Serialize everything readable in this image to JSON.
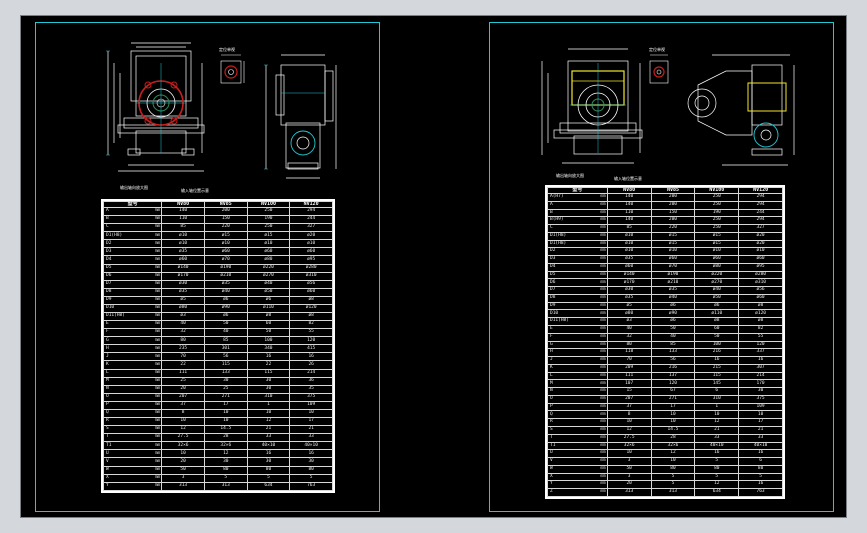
{
  "sheets": [
    {
      "captions": [
        "输出轴向放大图",
        "输入轴位置示意"
      ],
      "detail_label": "定位单视",
      "table": {
        "header": [
          "型号",
          "NV80",
          "NV85",
          "NV100",
          "NV120"
        ],
        "rows": [
          [
            "A",
            "mm",
            "140",
            "200",
            "250",
            "294"
          ],
          [
            "B",
            "mm",
            "110",
            "150",
            "190",
            "244"
          ],
          [
            "C",
            "mm",
            "85",
            "220",
            "250",
            "327"
          ],
          [
            "D1(H8)",
            "mm",
            "ø10",
            "ø15",
            "ø15",
            "ø20"
          ],
          [
            "D2",
            "mm",
            "ø10",
            "ø10",
            "ø10",
            "ø10"
          ],
          [
            "D3",
            "mm",
            "ø35",
            "ø60",
            "ø60",
            "ø60"
          ],
          [
            "D4",
            "mm",
            "ø60",
            "ø70",
            "ø80",
            "ø95"
          ],
          [
            "D5",
            "mm",
            "ø140",
            "ø190",
            "ø220",
            "ø280"
          ],
          [
            "D6",
            "mm",
            "ø170",
            "ø210",
            "ø270",
            "ø310"
          ],
          [
            "D7",
            "mm",
            "ø30",
            "ø35",
            "ø40",
            "ø56"
          ],
          [
            "D8",
            "mm",
            "ø35",
            "ø40",
            "ø50",
            "ø60"
          ],
          [
            "D9",
            "mm",
            "ø5",
            "ø6",
            "ø6",
            "ø8"
          ],
          [
            "D10",
            "mm",
            "ø80",
            "ø90",
            "ø110",
            "ø120"
          ],
          [
            "D11(H8)",
            "mm",
            "ø3",
            "ø6",
            "ø8",
            "ø8"
          ],
          [
            "E",
            "mm",
            "40",
            "50",
            "60",
            "82"
          ],
          [
            "F",
            "mm",
            "32",
            "40",
            "50",
            "55"
          ],
          [
            "G",
            "mm",
            "80",
            "85",
            "100",
            "120"
          ],
          [
            "H",
            "mm",
            "235",
            "301",
            "340",
            "415"
          ],
          [
            "J",
            "mm",
            "70",
            "56",
            "16",
            "16"
          ],
          [
            "K",
            "mm",
            "22",
            "115",
            "22",
            "26"
          ],
          [
            "L",
            "mm",
            "111",
            "133",
            "115",
            "214"
          ],
          [
            "M",
            "mm",
            "25",
            "30",
            "30",
            "36"
          ],
          [
            "N",
            "mm",
            "20",
            "25",
            "30",
            "35"
          ],
          [
            "O",
            "mm",
            "207",
            "271",
            "310",
            "375"
          ],
          [
            "P",
            "mm",
            "37",
            "17",
            "1",
            "109"
          ],
          [
            "Q",
            "mm",
            "8",
            "10",
            "10",
            "10"
          ],
          [
            "R",
            "mm",
            "10",
            "10",
            "12",
            "17"
          ],
          [
            "S",
            "mm",
            "12",
            "14.5",
            "21",
            "21"
          ],
          [
            "T",
            "mm",
            "27.5",
            "28",
            "33",
            "33"
          ],
          [
            "T1",
            "mm",
            "32×6",
            "32×6",
            "40×10",
            "40×10"
          ],
          [
            "U",
            "mm",
            "10",
            "12",
            "16",
            "16"
          ],
          [
            "V",
            "mm",
            "20",
            "30",
            "30",
            "30"
          ],
          [
            "W",
            "mm",
            "50",
            "80",
            "80",
            "80"
          ],
          [
            "X",
            "mm",
            "3",
            "5",
            "5",
            "5"
          ],
          [
            "Y",
            "mm",
            "313",
            "313",
            "634",
            "763"
          ]
        ]
      }
    },
    {
      "captions": [
        "输出轴向放大图",
        "输入轴位置示意"
      ],
      "detail_label": "定位单视",
      "table": {
        "header": [
          "型号",
          "NV80",
          "NV85",
          "NV100",
          "NV120"
        ],
        "rows": [
          [
            "A(H7)",
            "mm",
            "140",
            "200",
            "250",
            "294"
          ],
          [
            "A",
            "mm",
            "140",
            "200",
            "250",
            "294"
          ],
          [
            "B",
            "mm",
            "110",
            "150",
            "190",
            "244"
          ],
          [
            "B(H9)",
            "mm",
            "140",
            "200",
            "250",
            "294"
          ],
          [
            "C",
            "mm",
            "85",
            "220",
            "250",
            "327"
          ],
          [
            "D1(H8)",
            "mm",
            "ø10",
            "ø15",
            "ø15",
            "ø20"
          ],
          [
            "D1(H8)",
            "mm",
            "ø10",
            "ø15",
            "ø15",
            "ø20"
          ],
          [
            "D2",
            "mm",
            "ø10",
            "ø10",
            "ø10",
            "ø10"
          ],
          [
            "D3",
            "mm",
            "ø35",
            "ø60",
            "ø60",
            "ø60"
          ],
          [
            "D4",
            "mm",
            "ø60",
            "ø70",
            "ø80",
            "ø95"
          ],
          [
            "D5",
            "mm",
            "ø140",
            "ø190",
            "ø220",
            "ø280"
          ],
          [
            "D6",
            "mm",
            "ø170",
            "ø210",
            "ø270",
            "ø310"
          ],
          [
            "D7",
            "mm",
            "ø30",
            "ø35",
            "ø40",
            "ø56"
          ],
          [
            "D8",
            "mm",
            "ø35",
            "ø40",
            "ø50",
            "ø60"
          ],
          [
            "D9",
            "mm",
            "ø5",
            "ø6",
            "ø6",
            "ø8"
          ],
          [
            "D10",
            "mm",
            "ø80",
            "ø90",
            "ø110",
            "ø120"
          ],
          [
            "D11(H8)",
            "mm",
            "ø3",
            "ø6",
            "ø8",
            "ø8"
          ],
          [
            "E",
            "mm",
            "40",
            "50",
            "60",
            "82"
          ],
          [
            "F",
            "mm",
            "32",
            "40",
            "50",
            "55"
          ],
          [
            "G",
            "mm",
            "80",
            "85",
            "100",
            "120"
          ],
          [
            "H",
            "mm",
            "118",
            "133",
            "216",
            "337"
          ],
          [
            "J",
            "mm",
            "70",
            "56",
            "16",
            "16"
          ],
          [
            "K",
            "mm",
            "209",
            "216",
            "215",
            "307"
          ],
          [
            "L",
            "mm",
            "111",
            "137",
            "115",
            "214"
          ],
          [
            "M",
            "mm",
            "107",
            "120",
            "145",
            "170"
          ],
          [
            "N",
            "mm",
            "15",
            "67",
            "6",
            "30"
          ],
          [
            "O",
            "mm",
            "207",
            "271",
            "310",
            "375"
          ],
          [
            "P",
            "mm",
            "37",
            "17",
            "1",
            "109"
          ],
          [
            "Q",
            "mm",
            "8",
            "10",
            "10",
            "10"
          ],
          [
            "R",
            "mm",
            "10",
            "10",
            "12",
            "17"
          ],
          [
            "S",
            "mm",
            "12",
            "14.5",
            "21",
            "21"
          ],
          [
            "T",
            "mm",
            "27.5",
            "28",
            "33",
            "33"
          ],
          [
            "T1",
            "mm",
            "32×6",
            "32×6",
            "40×10",
            "40×10"
          ],
          [
            "U",
            "mm",
            "10",
            "12",
            "16",
            "16"
          ],
          [
            "V",
            "mm",
            "3",
            "10",
            "5",
            "6"
          ],
          [
            "W",
            "mm",
            "50",
            "80",
            "80",
            "80"
          ],
          [
            "X",
            "mm",
            "3",
            "5",
            "5",
            "5"
          ],
          [
            "Y",
            "mm",
            "20",
            "5",
            "12",
            "16"
          ],
          [
            "Z",
            "mm",
            "313",
            "313",
            "634",
            "763"
          ]
        ]
      }
    }
  ],
  "colors": {
    "background": "#000000",
    "frame": "#20c8d6",
    "lines": "#ffffff",
    "accent": "#c81e1e",
    "highlight": "#f2e62b"
  }
}
